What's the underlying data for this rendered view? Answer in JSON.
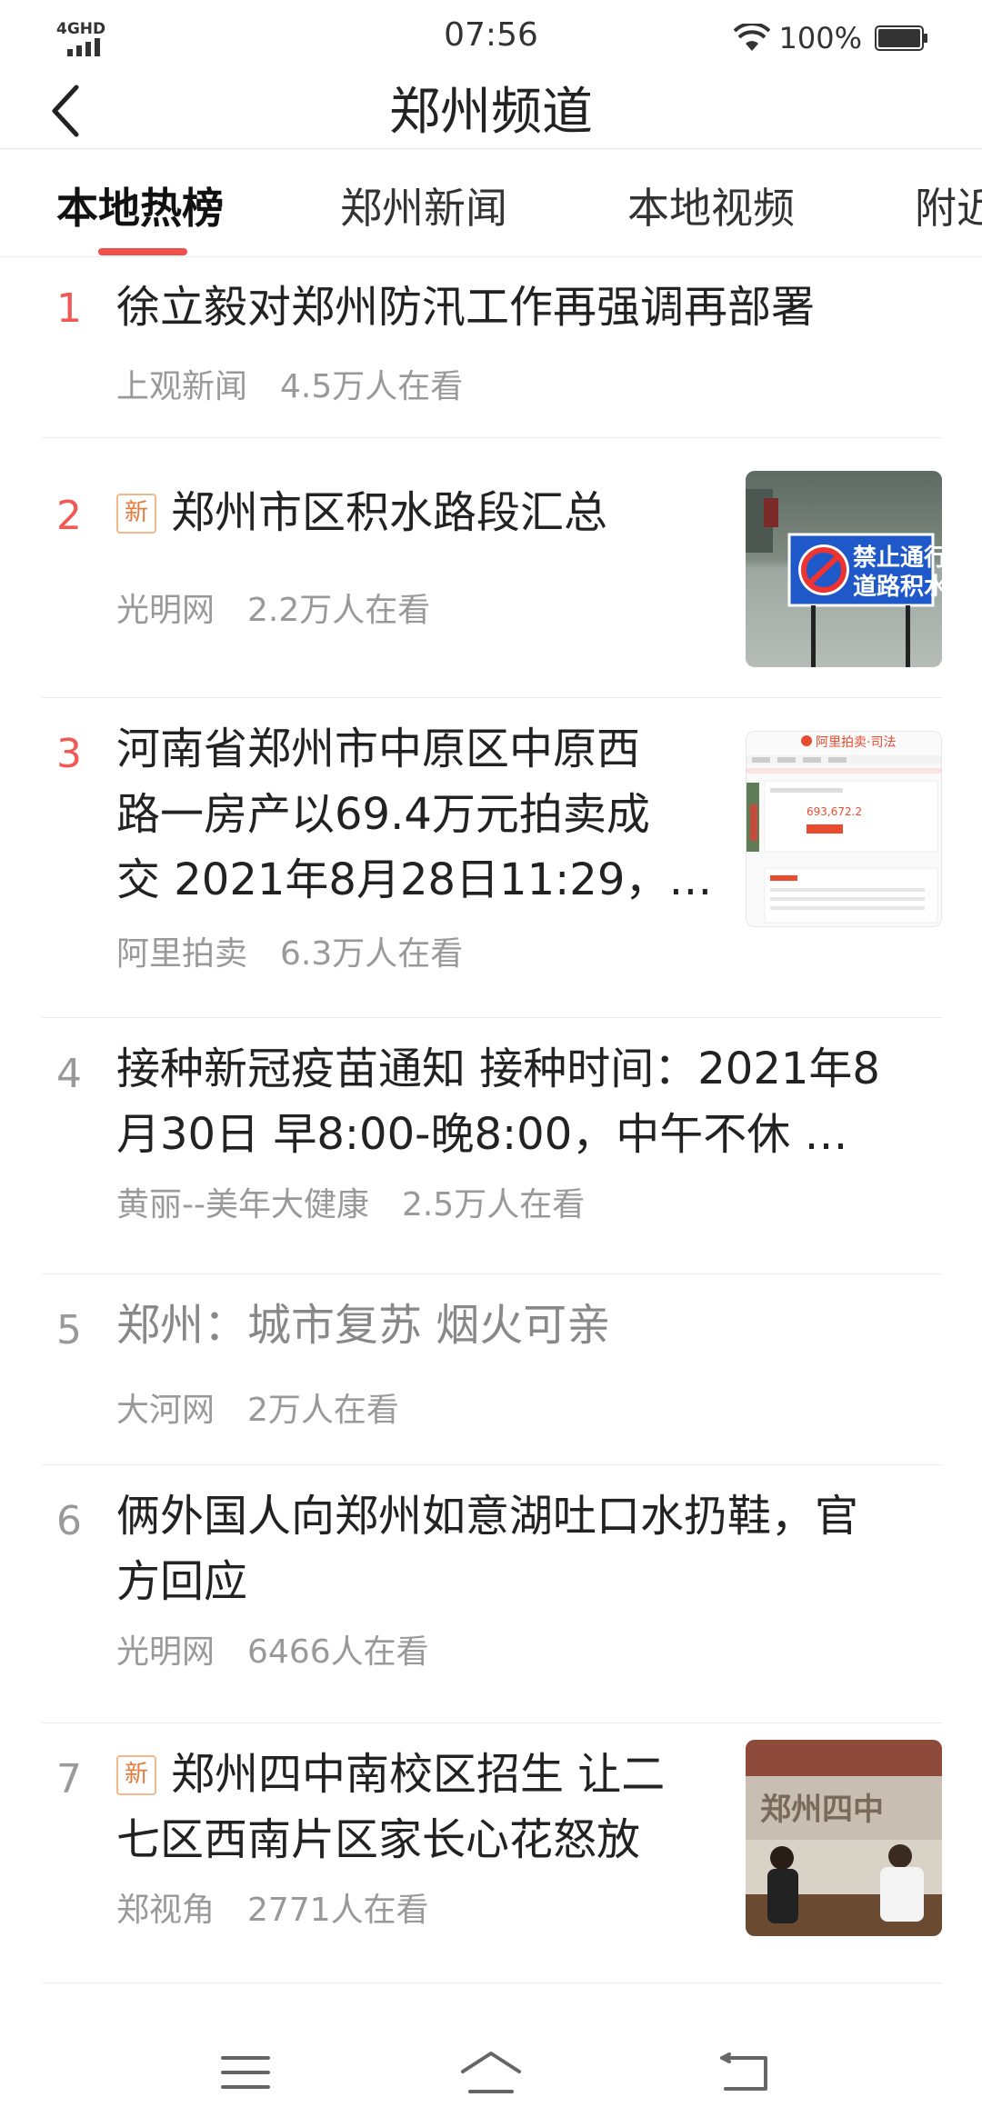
{
  "status": {
    "network": "4GHD",
    "time": "07:56",
    "battery": "100%"
  },
  "header": {
    "title": "郑州频道",
    "back_icon": "chevron-left-icon"
  },
  "tabs": [
    {
      "label": "本地热榜",
      "active": true
    },
    {
      "label": "郑州新闻",
      "active": false
    },
    {
      "label": "本地视频",
      "active": false
    },
    {
      "label": "附近",
      "active": false
    }
  ],
  "items": [
    {
      "rank": "1",
      "title": "徐立毅对郑州防汛工作再强调再部署",
      "new": false,
      "source": "上观新闻",
      "views": "4.5万人在看"
    },
    {
      "rank": "2",
      "title": "郑州市区积水路段汇总",
      "new": true,
      "badge": "新",
      "source": "光明网",
      "views": "2.2万人在看",
      "thumb_text": "禁止通行 道路积水"
    },
    {
      "rank": "3",
      "title_lines": [
        "河南省郑州市中原区中原西",
        "路一房产以69.4万元拍卖成",
        "交 2021年8月28日11:29，…"
      ],
      "new": false,
      "source": "阿里拍卖",
      "views": "6.3万人在看",
      "thumb_title": "阿里拍卖·司法",
      "thumb_price": "693,672.2"
    },
    {
      "rank": "4",
      "title_lines": [
        "接种新冠疫苗通知 接种时间：2021年8",
        "月30日 早8:00-晚8:00，中午不休 …"
      ],
      "new": false,
      "source": "黄丽--美年大健康",
      "views": "2.5万人在看"
    },
    {
      "rank": "5",
      "title": "郑州：城市复苏 烟火可亲",
      "new": false,
      "read": true,
      "source": "大河网",
      "views": "2万人在看"
    },
    {
      "rank": "6",
      "title_lines": [
        "俩外国人向郑州如意湖吐口水扔鞋，官",
        "方回应"
      ],
      "new": false,
      "source": "光明网",
      "views": "6466人在看"
    },
    {
      "rank": "7",
      "title_lines": [
        "郑州四中南校区招生 让二",
        "七区西南片区家长心花怒放"
      ],
      "new": true,
      "badge": "新",
      "source": "郑视角",
      "views": "2771人在看",
      "thumb_text": "郑州四中"
    }
  ],
  "bottom_nav": {
    "menu_icon": "menu-icon",
    "home_icon": "home-icon",
    "back_icon": "return-icon"
  },
  "colors": {
    "accent": "#f04f4b",
    "rank_hot": "#ef5a55",
    "rank_normal": "#999999",
    "badge": "#e77a3a"
  }
}
